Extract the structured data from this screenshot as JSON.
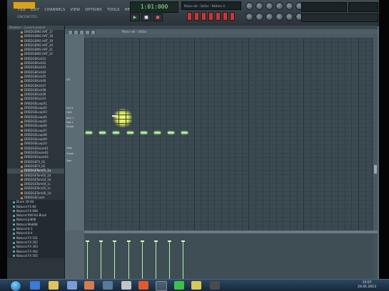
{
  "app": {
    "menu": [
      "FILE",
      "EDIT",
      "CHANNELS",
      "VIEW",
      "OPTIONS",
      "TOOLS",
      "HELP"
    ],
    "hint_text": "ONCENOTES",
    "lcd_time": "1:01:000",
    "transport": {
      "play": "▶",
      "stop": "■",
      "record": "●"
    },
    "pattern_display": "Piano roll - 3xOsc - Pattern 4"
  },
  "browser": {
    "header": "Browser - Current project",
    "items": [
      {
        "label": "DREDGEINS HAT_17",
        "kind": "sample"
      },
      {
        "label": "DREDGEINS HAT_18",
        "kind": "sample"
      },
      {
        "label": "DREDGEINS HAT_19",
        "kind": "sample"
      },
      {
        "label": "DREDGEINS HAT_20",
        "kind": "sample"
      },
      {
        "label": "DREDGEINS HAT_21",
        "kind": "sample"
      },
      {
        "label": "DREDGEINS HAT_22",
        "kind": "sample"
      },
      {
        "label": "DREDGEKick01",
        "kind": "sample"
      },
      {
        "label": "DREDGEKick02",
        "kind": "sample"
      },
      {
        "label": "DREDGEKick03",
        "kind": "sample"
      },
      {
        "label": "DREDGEKick04",
        "kind": "sample"
      },
      {
        "label": "DREDGEKick05",
        "kind": "sample"
      },
      {
        "label": "DREDGEKick06",
        "kind": "sample"
      },
      {
        "label": "DREDGEKick07",
        "kind": "sample"
      },
      {
        "label": "DREDGEKick08",
        "kind": "sample"
      },
      {
        "label": "DREDGEKick09",
        "kind": "sample"
      },
      {
        "label": "DREDGEKick10",
        "kind": "sample"
      },
      {
        "label": "DREDGELoop01",
        "kind": "sample"
      },
      {
        "label": "DREDGELoop02",
        "kind": "sample"
      },
      {
        "label": "DREDGELoop03",
        "kind": "sample"
      },
      {
        "label": "DREDGELoop04",
        "kind": "sample"
      },
      {
        "label": "DREDGELoop05",
        "kind": "sample"
      },
      {
        "label": "DREDGELoop06",
        "kind": "sample"
      },
      {
        "label": "DREDGELoop07",
        "kind": "sample"
      },
      {
        "label": "DREDGELoop08",
        "kind": "sample"
      },
      {
        "label": "DREDGELoop09",
        "kind": "sample"
      },
      {
        "label": "DREDGELoop10",
        "kind": "sample"
      },
      {
        "label": "DREDGESnare01",
        "kind": "sample"
      },
      {
        "label": "DREDGESnare02",
        "kind": "sample"
      },
      {
        "label": "DREDGESnare03",
        "kind": "sample"
      },
      {
        "label": "DREDGEFX_01",
        "kind": "sample"
      },
      {
        "label": "DREDGEFX_02",
        "kind": "sample"
      },
      {
        "label": "DREDGETom01_1a",
        "kind": "sample",
        "selected": true
      },
      {
        "label": "DREDGETom02_1b",
        "kind": "sample"
      },
      {
        "label": "DREDGETom03_1b",
        "kind": "sample"
      },
      {
        "label": "DREDGETom04_1c",
        "kind": "sample"
      },
      {
        "label": "DREDGETom05_1c",
        "kind": "sample"
      },
      {
        "label": "DREDGETom06_1d",
        "kind": "sample"
      },
      {
        "label": "DREDGECrash",
        "kind": "sample"
      },
      {
        "label": "Drum 3D Kit",
        "kind": "plugin"
      },
      {
        "label": "Natural FX Kit",
        "kind": "plugin"
      },
      {
        "label": "Natural FX 808",
        "kind": "plugin"
      },
      {
        "label": "Natural 909 Kit Black",
        "kind": "plugin"
      },
      {
        "label": "Natural Jo808",
        "kind": "plugin"
      },
      {
        "label": "Natural Me808",
        "kind": "plugin"
      },
      {
        "label": "Natural 8-3",
        "kind": "plugin"
      },
      {
        "label": "Natural 8-4",
        "kind": "plugin"
      },
      {
        "label": "Natural FX 101",
        "kind": "plugin"
      },
      {
        "label": "Natural FX 202",
        "kind": "plugin"
      },
      {
        "label": "Natural FX 303",
        "kind": "plugin"
      },
      {
        "label": "Natural FX 404",
        "kind": "plugin"
      },
      {
        "label": "Natural FX 505",
        "kind": "plugin"
      }
    ]
  },
  "piano_roll": {
    "toolbar_text": "Piano roll - 3xOsc",
    "key_labels": [
      "C6",
      "Oct 5",
      "G#5",
      "Kick 1",
      "Hat 1",
      "Snare",
      "Clap",
      "Crash",
      "Tom"
    ],
    "notes_count": 8,
    "velocity_levels": [
      0.85,
      0.85,
      0.85,
      0.85,
      0.85,
      0.85,
      0.85,
      0.85
    ]
  },
  "taskbar": {
    "time": "15:07",
    "date": "24.01.2013"
  }
}
